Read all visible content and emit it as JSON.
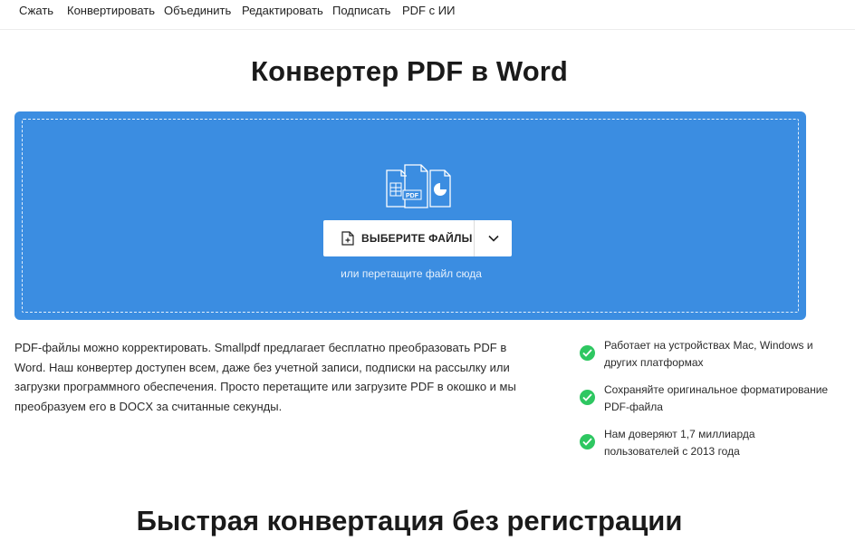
{
  "nav": {
    "items": [
      "Сжать",
      "Конвертировать",
      "Объединить",
      "Редактировать",
      "Подписать",
      "PDF с ИИ"
    ]
  },
  "main": {
    "title": "Конвертер PDF в Word",
    "dropzone": {
      "choose_label": "ВЫБЕРИТЕ ФАЙЛЫ",
      "hint": "или перетащите файл сюда",
      "illustration_badge": "PDF"
    },
    "description": "PDF-файлы можно корректировать. Smallpdf предлагает бесплатно преобразовать PDF в Word. Наш конвертер доступен всем, даже без учетной записи, подписки на рассылку или загрузки программного обеспечения. Просто перетащите или загрузите PDF в окошко и мы преобразуем его в DOCX за считанные секунды.",
    "features": [
      "Работает на устройствах Mac, Windows и других платформах",
      "Сохраняйте оригинальное форматирование PDF-файла",
      "Нам доверяют 1,7 миллиарда пользователей с 2013 года"
    ]
  },
  "section": {
    "title": "Быстрая конвертация без регистрации"
  },
  "colors": {
    "dropzone": "#3b8de1",
    "check": "#2ec761"
  }
}
